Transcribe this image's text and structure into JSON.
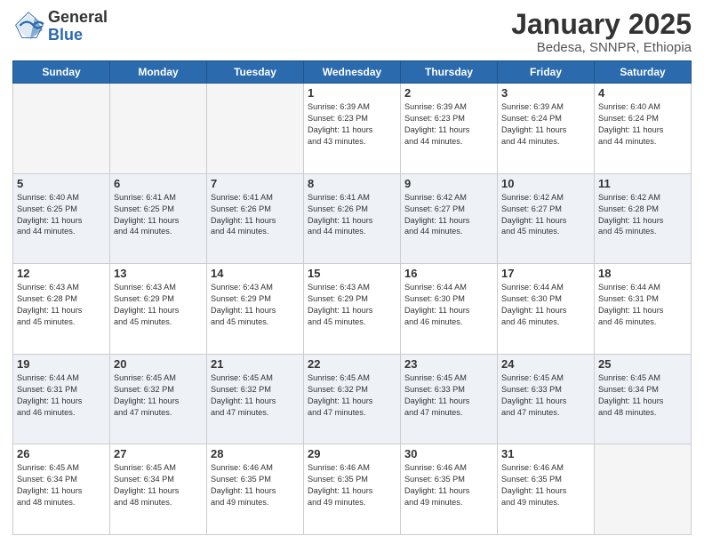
{
  "logo": {
    "general": "General",
    "blue": "Blue"
  },
  "header": {
    "month": "January 2025",
    "location": "Bedesa, SNNPR, Ethiopia"
  },
  "weekdays": [
    "Sunday",
    "Monday",
    "Tuesday",
    "Wednesday",
    "Thursday",
    "Friday",
    "Saturday"
  ],
  "weeks": [
    [
      {
        "day": null
      },
      {
        "day": null
      },
      {
        "day": null
      },
      {
        "day": "1",
        "sunrise": "6:39 AM",
        "sunset": "6:23 PM",
        "daylight": "11 hours and 43 minutes."
      },
      {
        "day": "2",
        "sunrise": "6:39 AM",
        "sunset": "6:23 PM",
        "daylight": "11 hours and 44 minutes."
      },
      {
        "day": "3",
        "sunrise": "6:39 AM",
        "sunset": "6:24 PM",
        "daylight": "11 hours and 44 minutes."
      },
      {
        "day": "4",
        "sunrise": "6:40 AM",
        "sunset": "6:24 PM",
        "daylight": "11 hours and 44 minutes."
      }
    ],
    [
      {
        "day": "5",
        "sunrise": "6:40 AM",
        "sunset": "6:25 PM",
        "daylight": "11 hours and 44 minutes."
      },
      {
        "day": "6",
        "sunrise": "6:41 AM",
        "sunset": "6:25 PM",
        "daylight": "11 hours and 44 minutes."
      },
      {
        "day": "7",
        "sunrise": "6:41 AM",
        "sunset": "6:26 PM",
        "daylight": "11 hours and 44 minutes."
      },
      {
        "day": "8",
        "sunrise": "6:41 AM",
        "sunset": "6:26 PM",
        "daylight": "11 hours and 44 minutes."
      },
      {
        "day": "9",
        "sunrise": "6:42 AM",
        "sunset": "6:27 PM",
        "daylight": "11 hours and 44 minutes."
      },
      {
        "day": "10",
        "sunrise": "6:42 AM",
        "sunset": "6:27 PM",
        "daylight": "11 hours and 45 minutes."
      },
      {
        "day": "11",
        "sunrise": "6:42 AM",
        "sunset": "6:28 PM",
        "daylight": "11 hours and 45 minutes."
      }
    ],
    [
      {
        "day": "12",
        "sunrise": "6:43 AM",
        "sunset": "6:28 PM",
        "daylight": "11 hours and 45 minutes."
      },
      {
        "day": "13",
        "sunrise": "6:43 AM",
        "sunset": "6:29 PM",
        "daylight": "11 hours and 45 minutes."
      },
      {
        "day": "14",
        "sunrise": "6:43 AM",
        "sunset": "6:29 PM",
        "daylight": "11 hours and 45 minutes."
      },
      {
        "day": "15",
        "sunrise": "6:43 AM",
        "sunset": "6:29 PM",
        "daylight": "11 hours and 45 minutes."
      },
      {
        "day": "16",
        "sunrise": "6:44 AM",
        "sunset": "6:30 PM",
        "daylight": "11 hours and 46 minutes."
      },
      {
        "day": "17",
        "sunrise": "6:44 AM",
        "sunset": "6:30 PM",
        "daylight": "11 hours and 46 minutes."
      },
      {
        "day": "18",
        "sunrise": "6:44 AM",
        "sunset": "6:31 PM",
        "daylight": "11 hours and 46 minutes."
      }
    ],
    [
      {
        "day": "19",
        "sunrise": "6:44 AM",
        "sunset": "6:31 PM",
        "daylight": "11 hours and 46 minutes."
      },
      {
        "day": "20",
        "sunrise": "6:45 AM",
        "sunset": "6:32 PM",
        "daylight": "11 hours and 47 minutes."
      },
      {
        "day": "21",
        "sunrise": "6:45 AM",
        "sunset": "6:32 PM",
        "daylight": "11 hours and 47 minutes."
      },
      {
        "day": "22",
        "sunrise": "6:45 AM",
        "sunset": "6:32 PM",
        "daylight": "11 hours and 47 minutes."
      },
      {
        "day": "23",
        "sunrise": "6:45 AM",
        "sunset": "6:33 PM",
        "daylight": "11 hours and 47 minutes."
      },
      {
        "day": "24",
        "sunrise": "6:45 AM",
        "sunset": "6:33 PM",
        "daylight": "11 hours and 47 minutes."
      },
      {
        "day": "25",
        "sunrise": "6:45 AM",
        "sunset": "6:34 PM",
        "daylight": "11 hours and 48 minutes."
      }
    ],
    [
      {
        "day": "26",
        "sunrise": "6:45 AM",
        "sunset": "6:34 PM",
        "daylight": "11 hours and 48 minutes."
      },
      {
        "day": "27",
        "sunrise": "6:45 AM",
        "sunset": "6:34 PM",
        "daylight": "11 hours and 48 minutes."
      },
      {
        "day": "28",
        "sunrise": "6:46 AM",
        "sunset": "6:35 PM",
        "daylight": "11 hours and 49 minutes."
      },
      {
        "day": "29",
        "sunrise": "6:46 AM",
        "sunset": "6:35 PM",
        "daylight": "11 hours and 49 minutes."
      },
      {
        "day": "30",
        "sunrise": "6:46 AM",
        "sunset": "6:35 PM",
        "daylight": "11 hours and 49 minutes."
      },
      {
        "day": "31",
        "sunrise": "6:46 AM",
        "sunset": "6:35 PM",
        "daylight": "11 hours and 49 minutes."
      },
      {
        "day": null
      }
    ]
  ]
}
